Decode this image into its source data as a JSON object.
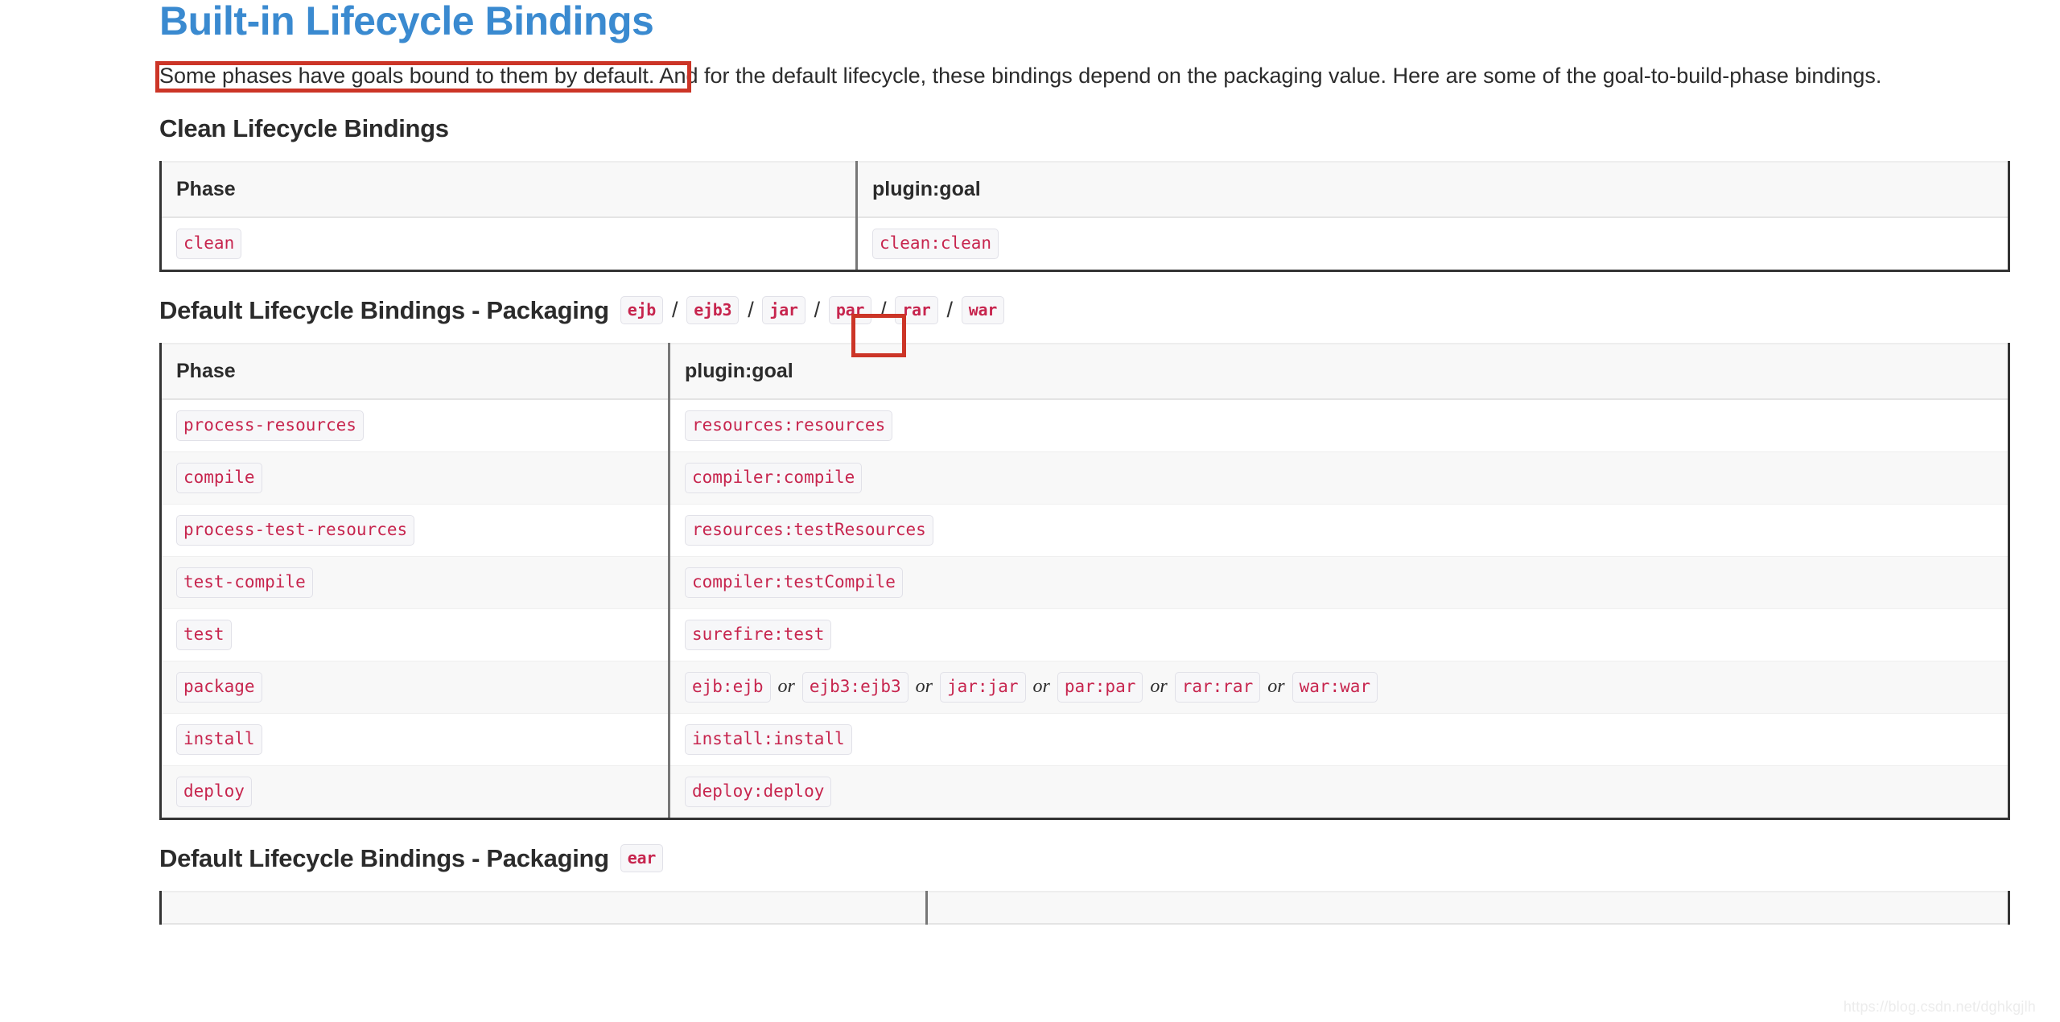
{
  "page": {
    "title": "Built-in Lifecycle Bindings",
    "intro_highlighted": "Some phases have goals bound to them by default.",
    "intro_rest": " And for the default lifecycle, these bindings depend on the packaging value. Here are some of the goal-to-build-phase bindings.",
    "watermark": "https://blog.csdn.net/dghkgjlh"
  },
  "colors": {
    "title_blue": "#3a8ad0",
    "code_text": "#c7254e",
    "code_bg": "#f7f7f9",
    "code_border": "#e1e1e8",
    "annotation_red": "#cc3527",
    "table_header_bg": "#f8f8f8",
    "table_outer_border": "#333333"
  },
  "clean_section": {
    "heading": "Clean Lifecycle Bindings",
    "columns": [
      "Phase",
      "plugin:goal"
    ],
    "rows": [
      {
        "phase": "clean",
        "goals": [
          "clean:clean"
        ]
      }
    ]
  },
  "default_section": {
    "heading": "Default Lifecycle Bindings - Packaging",
    "packagings": [
      "ejb",
      "ejb3",
      "jar",
      "par",
      "rar",
      "war"
    ],
    "packaging_separator": "/",
    "highlighted_packaging": "jar",
    "columns": [
      "Phase",
      "plugin:goal"
    ],
    "or_label": "or",
    "rows": [
      {
        "phase": "process-resources",
        "goals": [
          "resources:resources"
        ]
      },
      {
        "phase": "compile",
        "goals": [
          "compiler:compile"
        ]
      },
      {
        "phase": "process-test-resources",
        "goals": [
          "resources:testResources"
        ]
      },
      {
        "phase": "test-compile",
        "goals": [
          "compiler:testCompile"
        ]
      },
      {
        "phase": "test",
        "goals": [
          "surefire:test"
        ]
      },
      {
        "phase": "package",
        "goals": [
          "ejb:ejb",
          "ejb3:ejb3",
          "jar:jar",
          "par:par",
          "rar:rar",
          "war:war"
        ]
      },
      {
        "phase": "install",
        "goals": [
          "install:install"
        ]
      },
      {
        "phase": "deploy",
        "goals": [
          "deploy:deploy"
        ]
      }
    ]
  },
  "ear_section": {
    "heading": "Default Lifecycle Bindings - Packaging",
    "packagings": [
      "ear"
    ],
    "columns": [
      "",
      ""
    ],
    "rows": []
  }
}
